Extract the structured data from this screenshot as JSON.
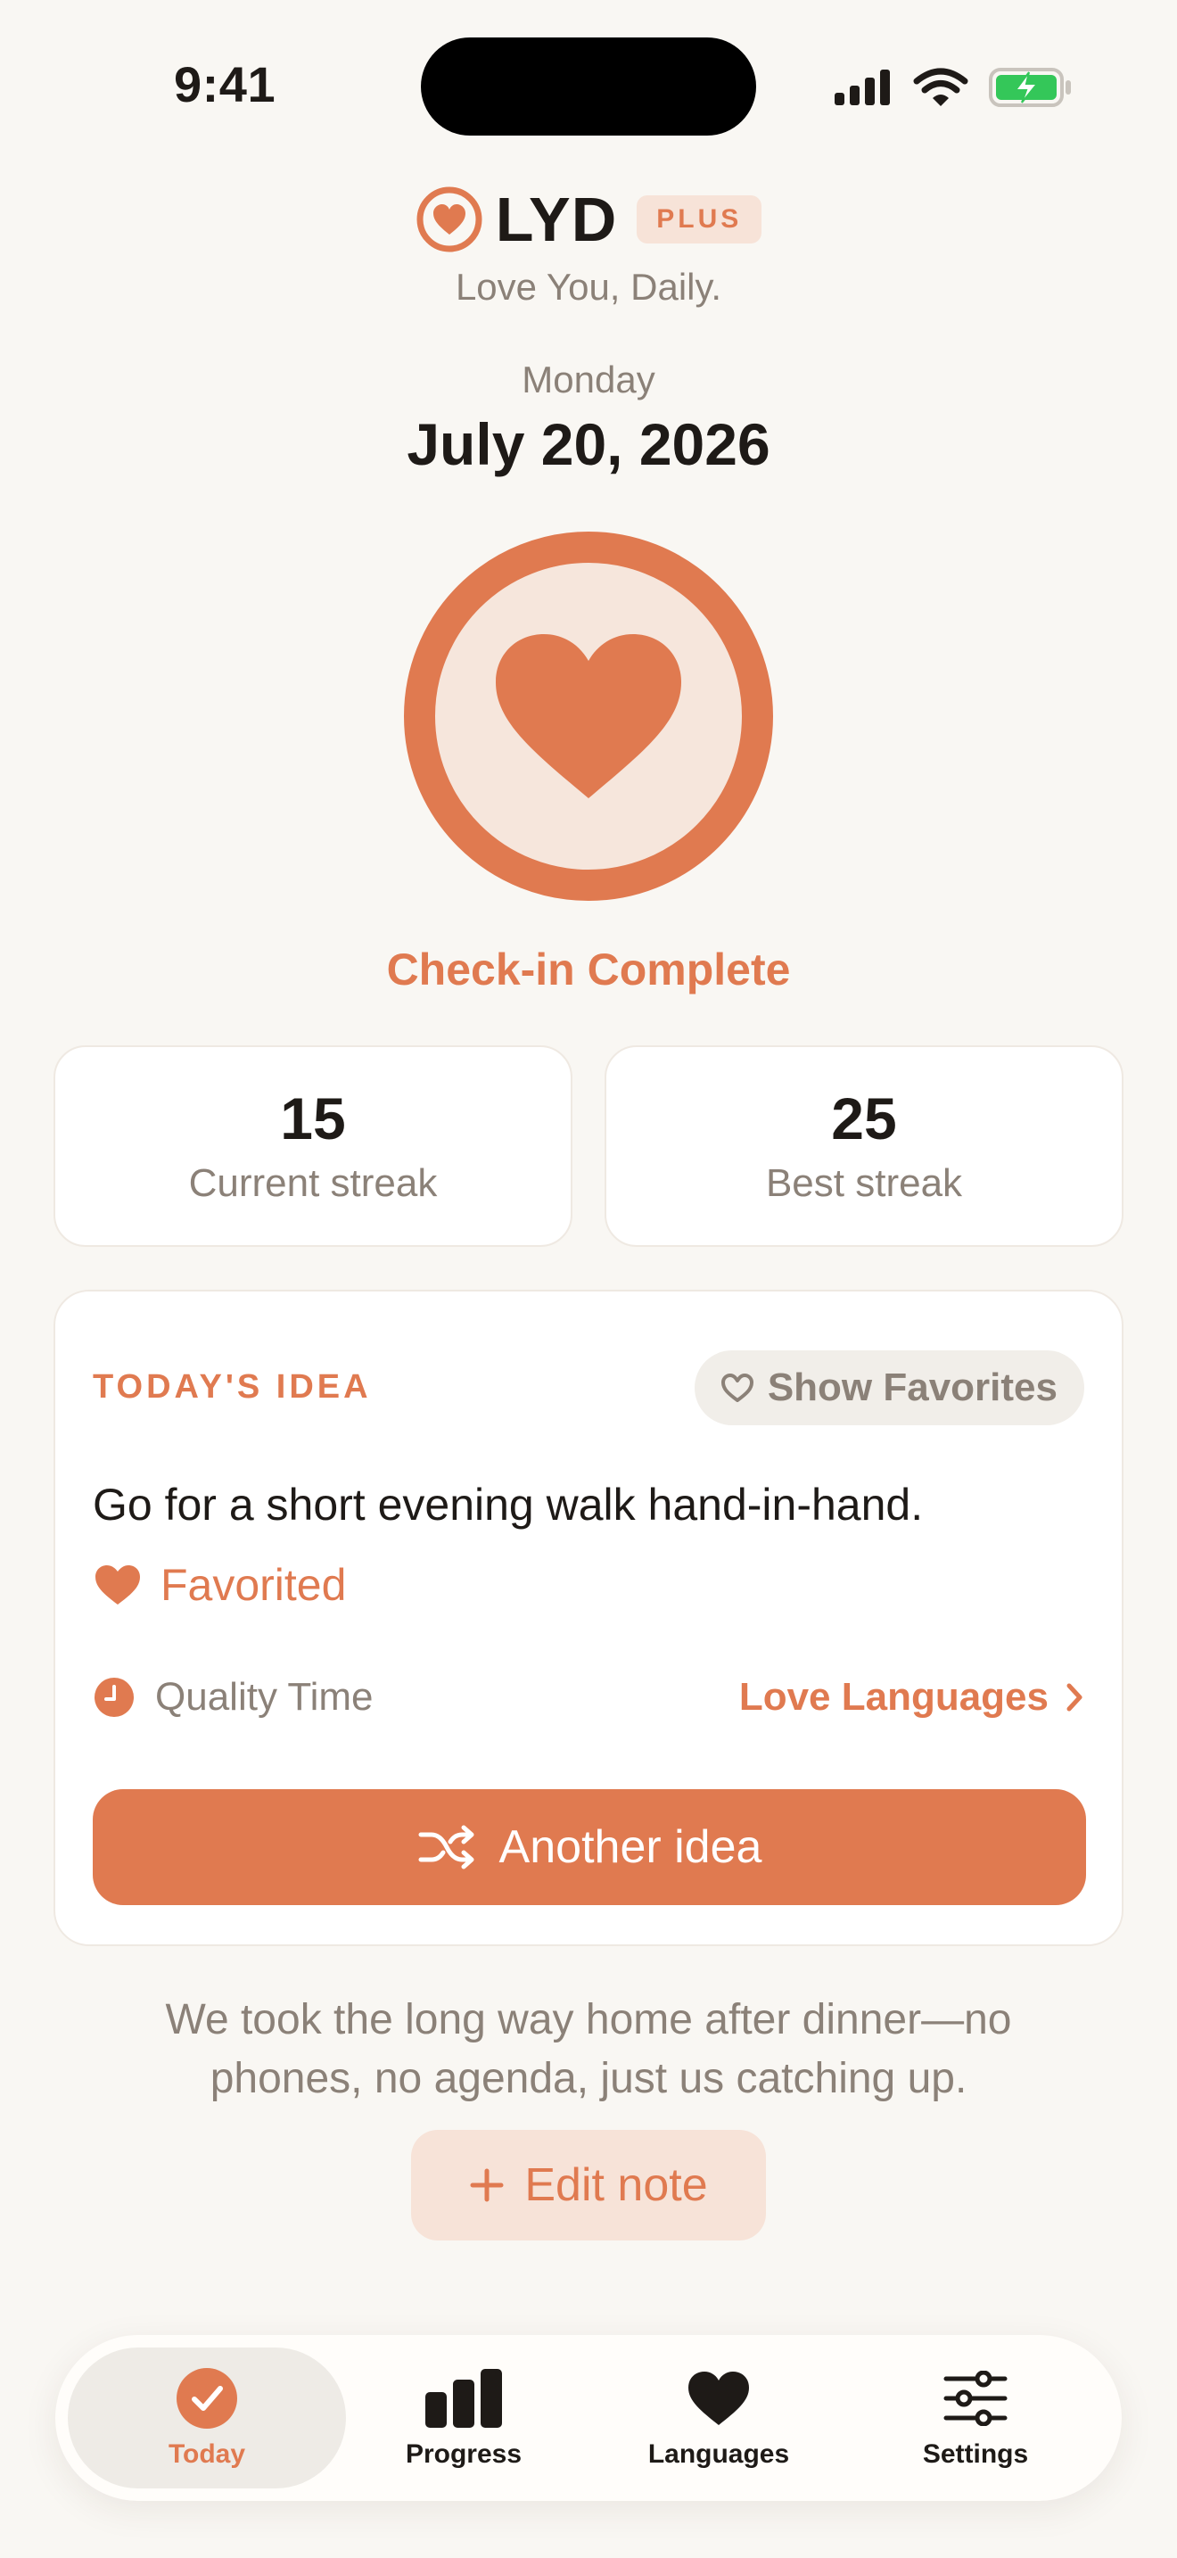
{
  "status_bar": {
    "time": "9:41"
  },
  "header": {
    "brand": "LYD",
    "badge": "PLUS",
    "tagline": "Love You, Daily.",
    "weekday": "Monday",
    "date": "July 20, 2026"
  },
  "check_in": {
    "label": "Check-in Complete"
  },
  "streaks": [
    {
      "value": "15",
      "label": "Current streak"
    },
    {
      "value": "25",
      "label": "Best streak"
    }
  ],
  "idea": {
    "eyebrow": "TODAY'S IDEA",
    "show_favorites_label": "Show Favorites",
    "text": "Go for a short evening walk hand-in-hand.",
    "favorited_label": "Favorited",
    "category": "Quality Time",
    "link_label": "Love Languages",
    "another_label": "Another idea"
  },
  "note": {
    "text": "We took the long way home after dinner—no phones, no agenda, just us catching up.",
    "edit_label": "Edit note"
  },
  "tabs": [
    {
      "label": "Today",
      "icon": "check-circle-icon",
      "active": true
    },
    {
      "label": "Progress",
      "icon": "bar-chart-icon",
      "active": false
    },
    {
      "label": "Languages",
      "icon": "heart-icon",
      "active": false
    },
    {
      "label": "Settings",
      "icon": "sliders-icon",
      "active": false
    }
  ],
  "colors": {
    "accent": "#e07a50",
    "accent_soft": "#f7e3d8",
    "background": "#f9f7f3",
    "text": "#1e1a17",
    "muted": "#8b8178",
    "battery": "#34c759"
  }
}
